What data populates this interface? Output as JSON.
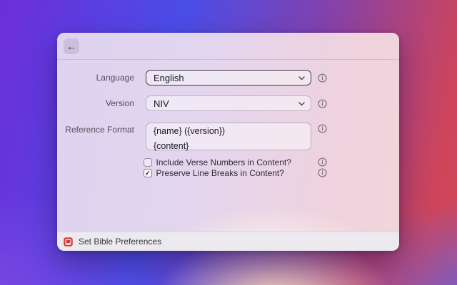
{
  "icons": {
    "back_arrow": "←",
    "check": "✓"
  },
  "form": {
    "language": {
      "label": "Language",
      "value": "English"
    },
    "version": {
      "label": "Version",
      "value": "NIV"
    },
    "reference_format": {
      "label": "Reference Format",
      "value": "{name} ({version})\n{content}"
    },
    "checkboxes": [
      {
        "label": "Include Verse Numbers in Content?",
        "checked": false
      },
      {
        "label": "Preserve Line Breaks in Content?",
        "checked": true
      }
    ]
  },
  "footer": {
    "command_name": "Set Bible Preferences"
  },
  "colors": {
    "accent_red": "#cf4040",
    "window_pink": "#f2d4dc",
    "window_lavender": "#ddd4f0",
    "footer_gray": "#eceaee"
  }
}
